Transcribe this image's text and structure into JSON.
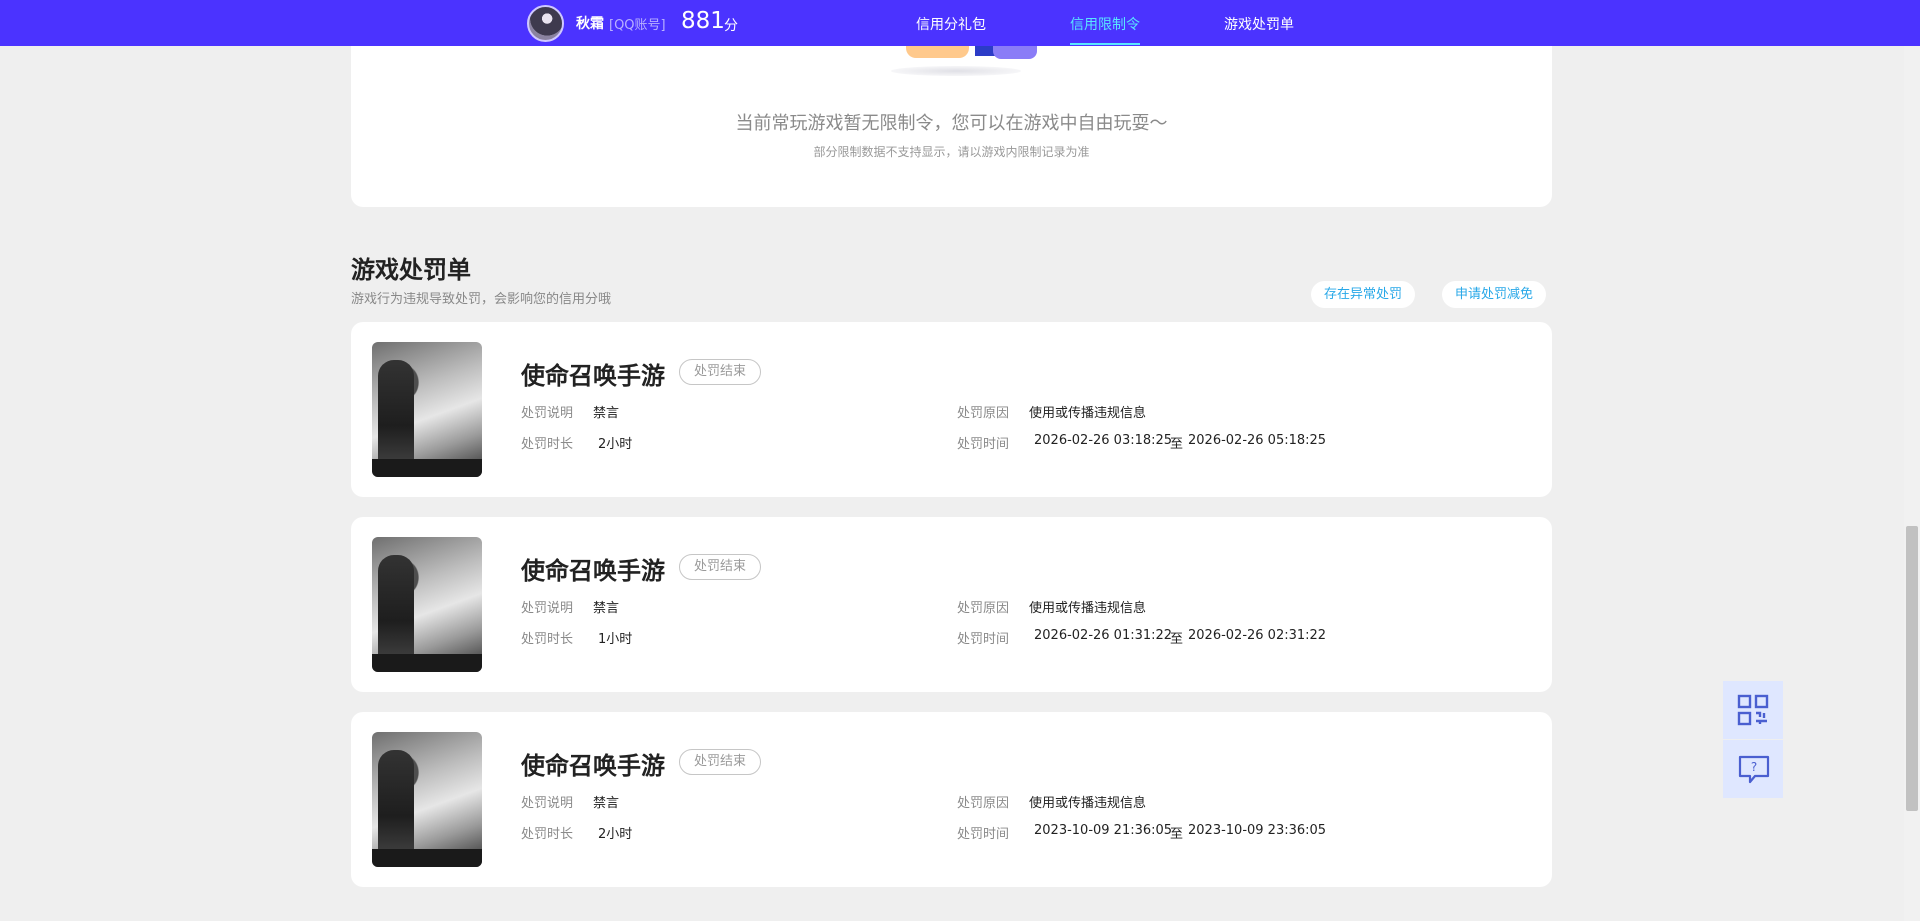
{
  "header": {
    "username": "秋霜",
    "account_type": "[QQ账号]",
    "score": "881",
    "score_unit": "分",
    "nav": [
      {
        "label": "信用分礼包",
        "active": false
      },
      {
        "label": "信用限制令",
        "active": true
      },
      {
        "label": "游戏处罚单",
        "active": false
      }
    ],
    "bar_color": "#4b33ff",
    "active_color": "#59e6ff"
  },
  "restriction": {
    "empty_message": "当前常玩游戏暂无限制令，您可以在游戏中自由玩耍～",
    "note": "部分限制数据不支持显示，请以游戏内限制记录为准"
  },
  "penalty_section": {
    "title": "游戏处罚单",
    "description": "游戏行为违规导致处罚，会影响您的信用分哦",
    "buttons": {
      "abnormal": "存在异常处罚",
      "appeal": "申请处罚减免"
    },
    "labels": {
      "desc": "处罚说明",
      "duration": "处罚时长",
      "reason": "处罚原因",
      "time": "处罚时间",
      "to": "至"
    },
    "items": [
      {
        "game": "使命召唤手游",
        "status": "处罚结束",
        "desc": "禁言",
        "duration": "2小时",
        "reason": "使用或传播违规信息",
        "start": "2026-02-26 03:18:25",
        "end": "2026-02-26 05:18:25"
      },
      {
        "game": "使命召唤手游",
        "status": "处罚结束",
        "desc": "禁言",
        "duration": "1小时",
        "reason": "使用或传播违规信息",
        "start": "2026-02-26 01:31:22",
        "end": "2026-02-26 02:31:22"
      },
      {
        "game": "使命召唤手游",
        "status": "处罚结束",
        "desc": "禁言",
        "duration": "2小时",
        "reason": "使用或传播违规信息",
        "start": "2023-10-09 21:36:05",
        "end": "2023-10-09 23:36:05"
      }
    ]
  },
  "float_tools": [
    {
      "icon": "qr-code-icon"
    },
    {
      "icon": "help-chat-icon"
    }
  ]
}
